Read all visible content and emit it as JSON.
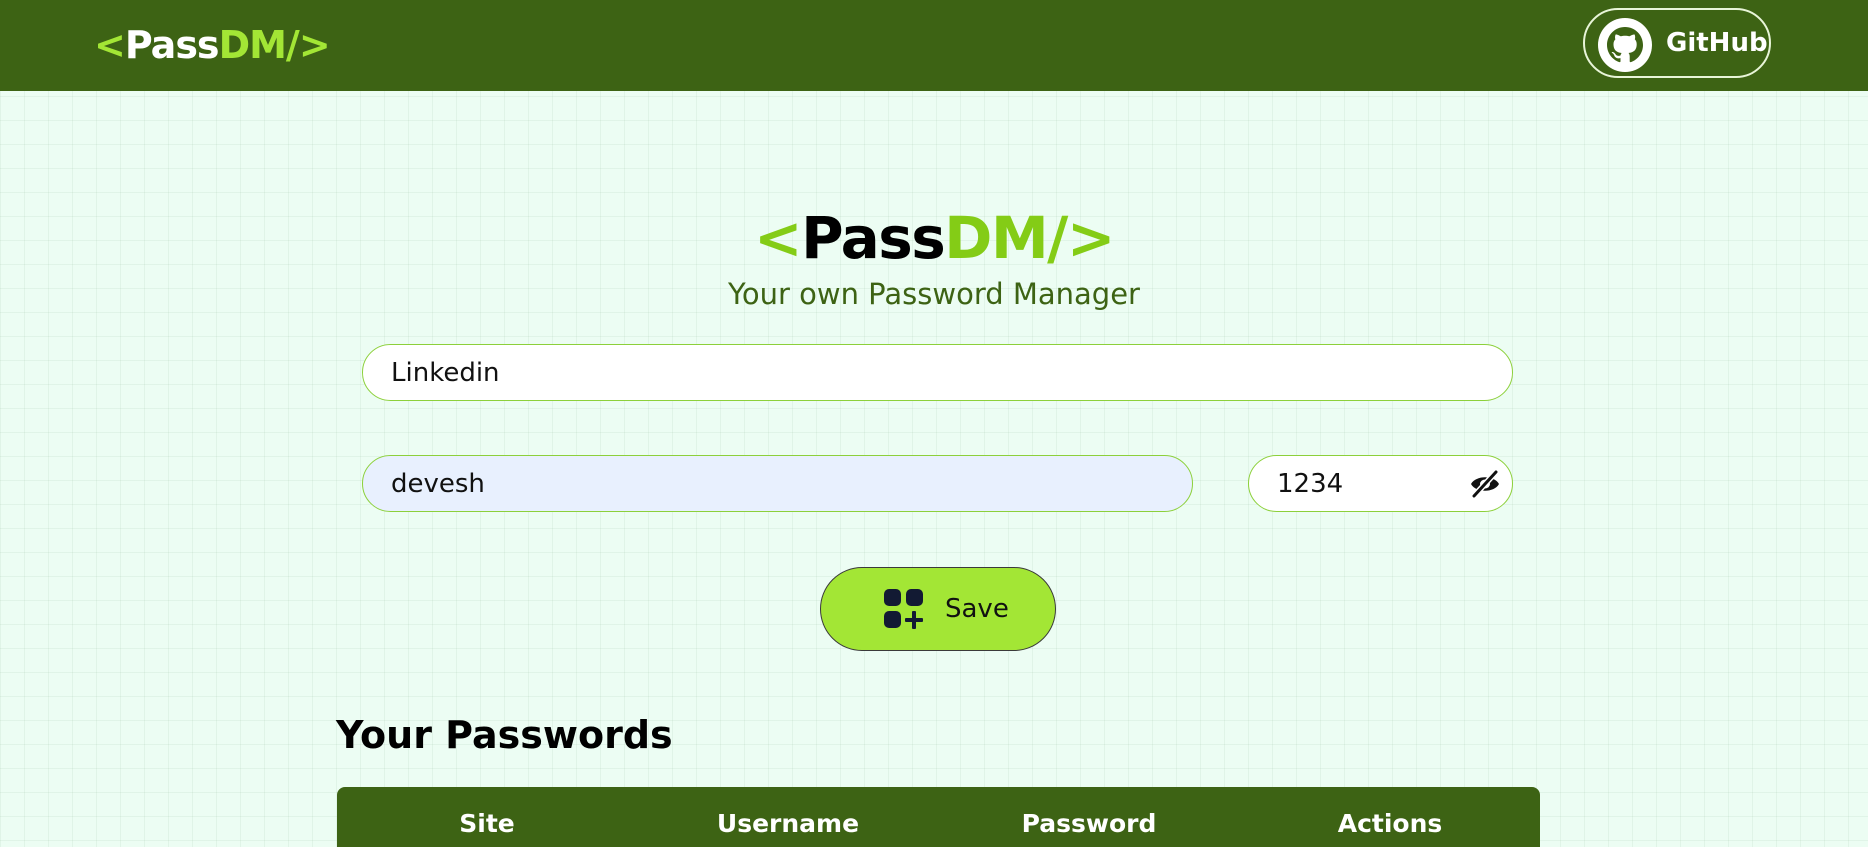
{
  "navbar": {
    "brand": {
      "open": "<",
      "word_white": "Pass",
      "word_green": "DM/",
      "close": ">"
    },
    "github_label": "GitHub",
    "github_icon": "github-icon"
  },
  "hero": {
    "open": "<",
    "word_dark": "Pass",
    "word_green": "DM/",
    "close": ">",
    "subtitle": "Your own Password Manager"
  },
  "form": {
    "site_value": "Linkedin",
    "username_value": "devesh",
    "password_value": "1234",
    "toggle_icon": "eye-slash-icon",
    "save_label": "Save",
    "save_icon": "add-grid-icon"
  },
  "passwords": {
    "heading": "Your Passwords",
    "columns": [
      "Site",
      "Username",
      "Password",
      "Actions"
    ]
  },
  "colors": {
    "navbar": "#3d6314",
    "accent": "#a3e635",
    "accent_dark": "#84cc16",
    "background": "#ecfdf3",
    "autofill": "#e8f0fe"
  }
}
